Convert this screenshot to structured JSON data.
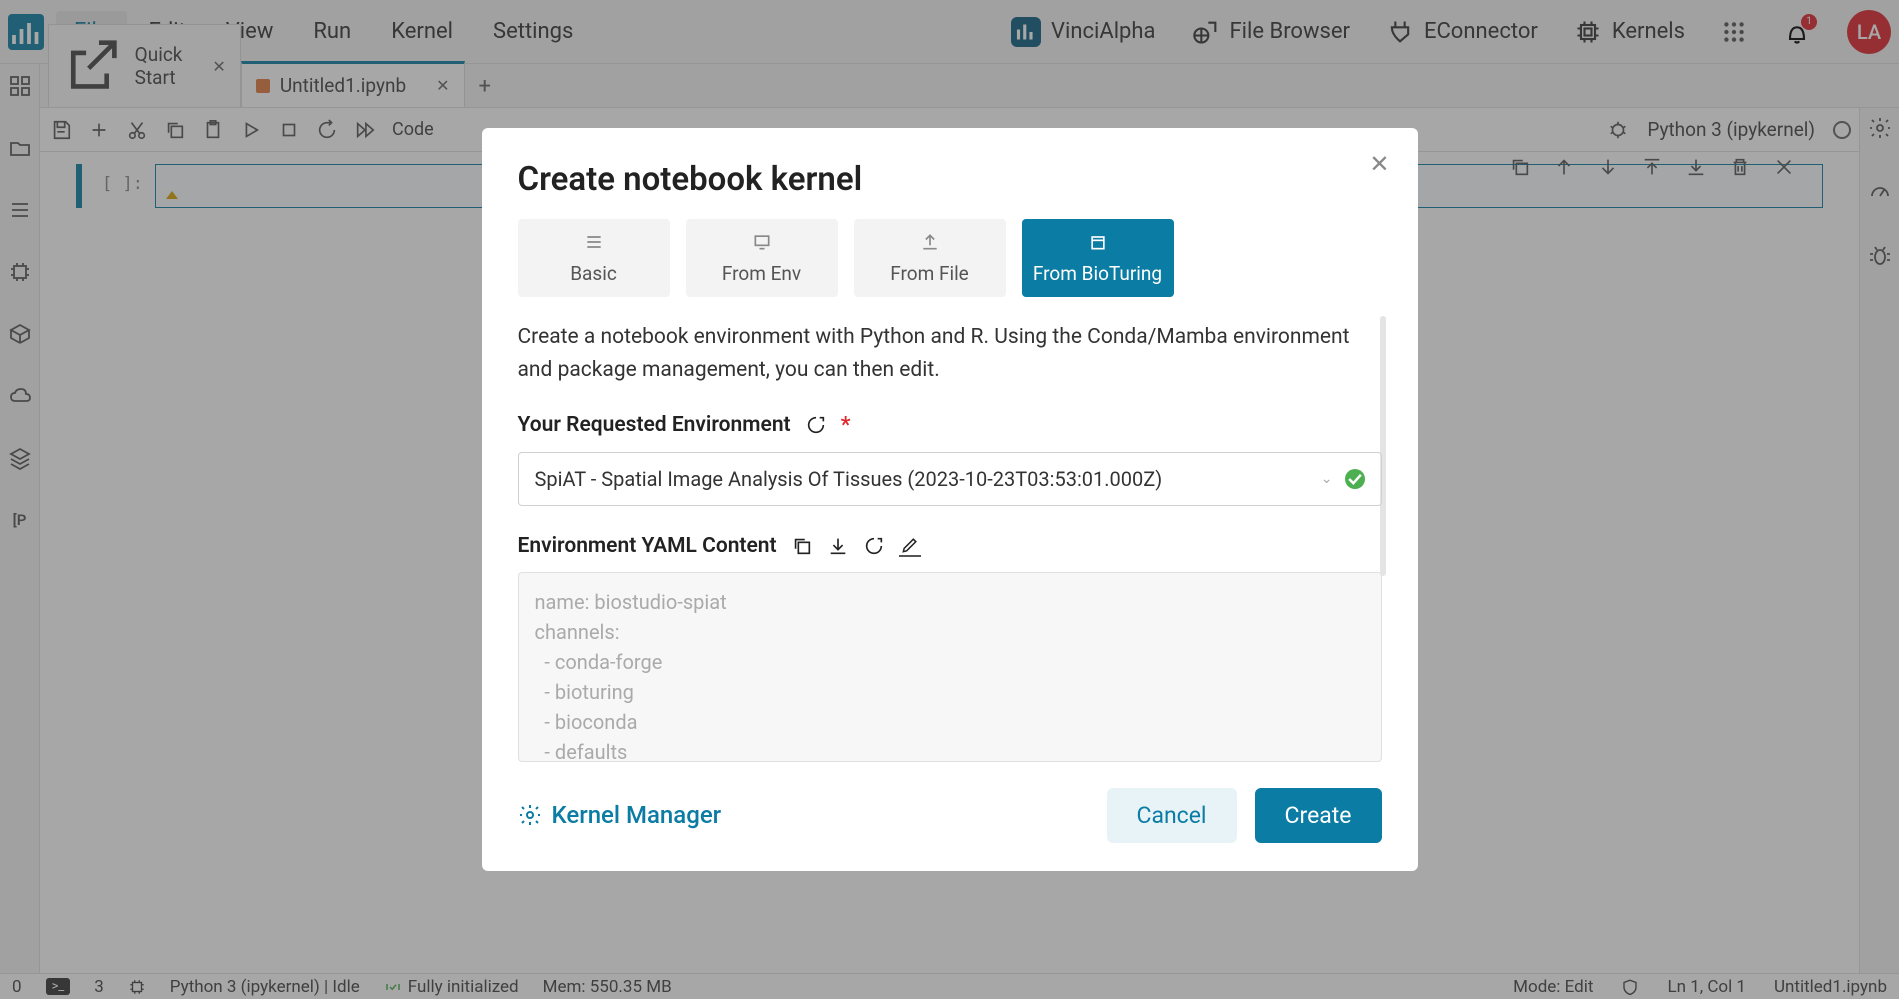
{
  "menubar": {
    "items": [
      "File",
      "Edit",
      "View",
      "Run",
      "Kernel",
      "Settings"
    ],
    "activeIndex": 0
  },
  "topLinks": {
    "vinci": "VinciAlpha",
    "fileBrowser": "File Browser",
    "econnector": "EConnector",
    "kernels": "Kernels"
  },
  "avatar": "LA",
  "notificationCount": "1",
  "tabs": [
    {
      "label": "Quick Start"
    },
    {
      "label": "Untitled1.ipynb"
    }
  ],
  "activeTab": 1,
  "toolbar": {
    "codeLabel": "Code"
  },
  "kernelDisplay": "Python 3 (ipykernel)",
  "cell": {
    "prompt": "[  ]:"
  },
  "modal": {
    "title": "Create notebook kernel",
    "tabs": [
      "Basic",
      "From Env",
      "From File",
      "From BioTuring"
    ],
    "activeTab": 3,
    "description": "Create a notebook environment with Python and R. Using the Conda/Mamba environment and package management, you can then edit.",
    "envLabel": "Your Requested Environment",
    "envValue": "SpiAT - Spatial Image Analysis Of Tissues (2023-10-23T03:53:01.000Z)",
    "yamlLabel": "Environment YAML Content",
    "yamlContent": "name: biostudio-spiat\nchannels:\n  - conda-forge\n  - bioturing\n  - bioconda\n  - defaults\ndependencies:",
    "kernelManager": "Kernel Manager",
    "cancel": "Cancel",
    "create": "Create"
  },
  "statusbar": {
    "zero": "0",
    "three": "3",
    "kernel": "Python 3 (ipykernel) | Idle",
    "init": "Fully initialized",
    "mem": "Mem: 550.35 MB",
    "mode": "Mode: Edit",
    "lncol": "Ln 1, Col 1",
    "filename": "Untitled1.ipynb"
  }
}
